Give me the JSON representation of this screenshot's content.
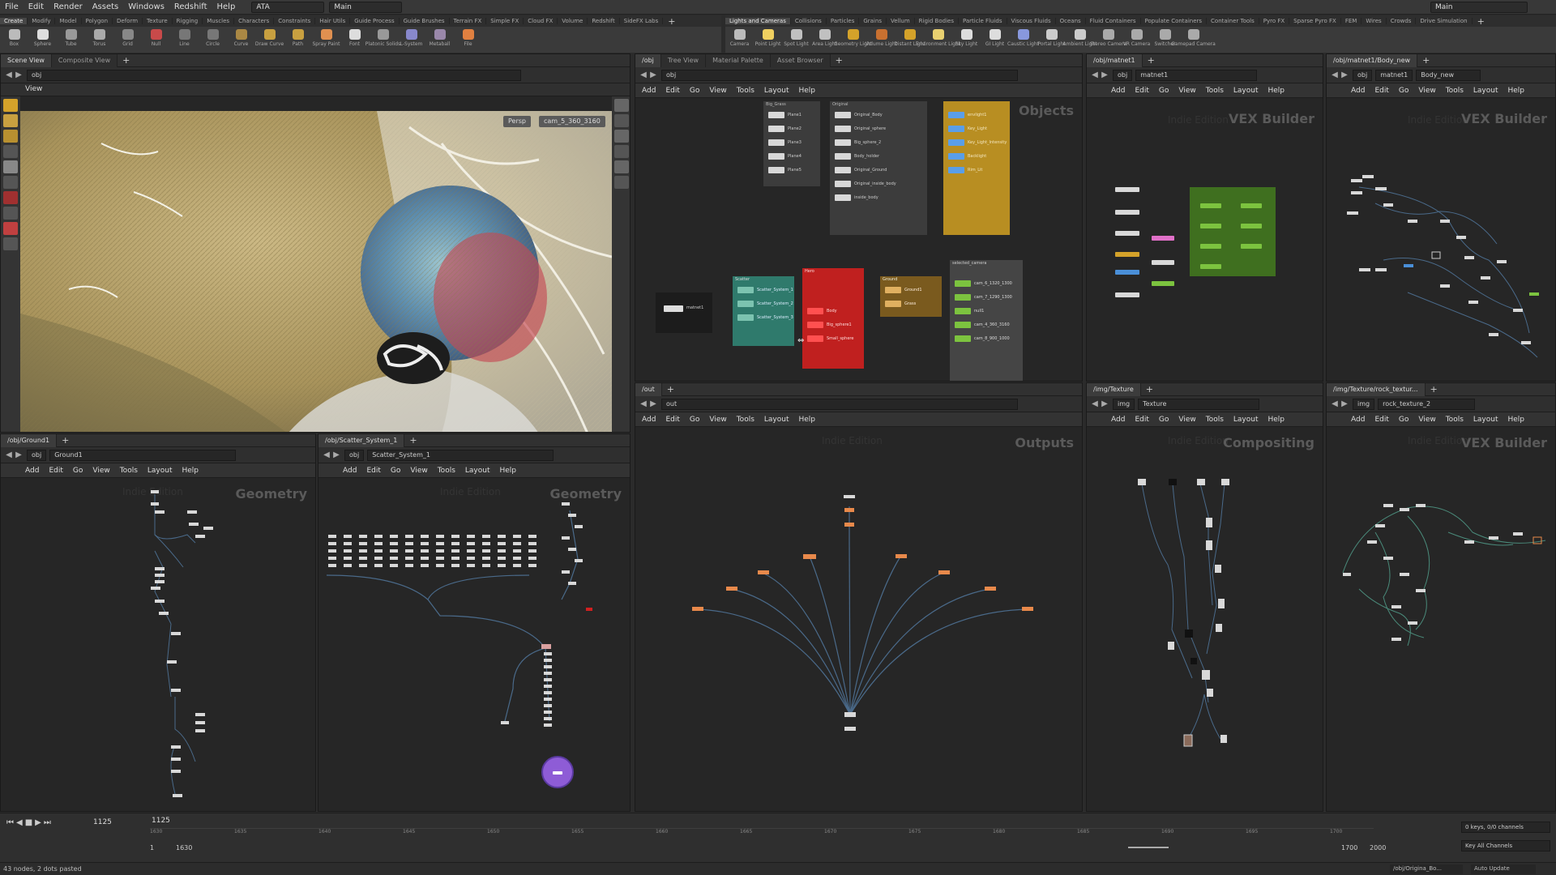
{
  "menu": {
    "items": [
      "File",
      "Edit",
      "Render",
      "Assets",
      "Windows",
      "Redshift",
      "Help"
    ],
    "desktop": "ATA",
    "desktop_right": "Main",
    "main_center": "Main"
  },
  "shelf_left": {
    "tabs": [
      "Create",
      "Modify",
      "Model",
      "Polygon",
      "Deform",
      "Texture",
      "Rigging",
      "Muscles",
      "Characters",
      "Constraints",
      "Hair Utils",
      "Guide Process",
      "Guide Brushes",
      "Terrain FX",
      "Simple FX",
      "Cloud FX",
      "Volume",
      "Redshift",
      "SideFX Labs"
    ],
    "tools": [
      "Box",
      "Sphere",
      "Tube",
      "Torus",
      "Grid",
      "Null",
      "Line",
      "Circle",
      "Curve",
      "Draw Curve",
      "Path",
      "Spray Paint",
      "Font",
      "Platonic Solids",
      "L-System",
      "Metaball",
      "File"
    ]
  },
  "shelf_right": {
    "tabs": [
      "Lights and Cameras",
      "Collisions",
      "Particles",
      "Grains",
      "Vellum",
      "Rigid Bodies",
      "Particle Fluids",
      "Viscous Fluids",
      "Oceans",
      "Fluid Containers",
      "Populate Containers",
      "Container Tools",
      "Pyro FX",
      "Sparse Pyro FX",
      "FEM",
      "Wires",
      "Crowds",
      "Drive Simulation"
    ],
    "tools": [
      "Camera",
      "Point Light",
      "Spot Light",
      "Area Light",
      "Geometry Light",
      "Volume Light",
      "Distant Light",
      "Environment Light",
      "Sky Light",
      "GI Light",
      "Caustic Light",
      "Portal Light",
      "Ambient Light",
      "Stereo Camera",
      "VR Camera",
      "Switcher",
      "Gamepad Camera"
    ]
  },
  "viewport": {
    "tabs": [
      "Scene View",
      "Composite View"
    ],
    "path": "obj",
    "title": "View",
    "persp": "Persp",
    "cam": "cam_5_360_3160"
  },
  "panes": {
    "obj": {
      "tabs": [
        "/obj",
        "Tree View",
        "Material Palette",
        "Asset Browser"
      ],
      "path": "obj",
      "menu": [
        "Add",
        "Edit",
        "Go",
        "View",
        "Tools",
        "Layout",
        "Help"
      ],
      "watermark": "Objects",
      "boxes": {
        "big_grass": "Big_Grass",
        "original": "Original",
        "lights": "",
        "scatter": "Scatter",
        "hero": "Hero",
        "ground": "Ground",
        "cameras": "selected_camera"
      },
      "grass_nodes": [
        "Plane1",
        "Plane2",
        "Plane3",
        "Plane4",
        "Plane5"
      ],
      "orig_nodes": [
        "Original_Body",
        "Original_sphere",
        "Big_sphere_2",
        "Body_holder",
        "Original_Ground",
        "Original_inside_body",
        "inside_body"
      ],
      "light_nodes": [
        "envlight1",
        "Key_Light",
        "Key_Light_Intensity",
        "Backlight",
        "Rim_Lit"
      ],
      "scatter_nodes": [
        "Scatter_System_1",
        "Scatter_System_2",
        "Scatter_System_3"
      ],
      "hero_nodes": [
        "Body",
        "Big_sphere1",
        "Small_sphere"
      ],
      "ground_nodes": [
        "Ground1",
        "Grass"
      ],
      "cam_nodes": [
        "cam_6_1320_1300",
        "cam_7_1290_1300",
        "null1",
        "cam_4_360_3160",
        "cam_8_900_1000"
      ],
      "matnet": "matnet1"
    },
    "vex1": {
      "tab": "/obj/matnet1",
      "path1": "obj",
      "path2": "matnet1",
      "menu": [
        "Add",
        "Edit",
        "Go",
        "View",
        "Tools",
        "Layout",
        "Help"
      ],
      "indie": "Indie Edition",
      "watermark": "VEX Builder"
    },
    "vex2": {
      "tab": "/obj/matnet1/Body_new",
      "path1": "obj",
      "path2": "matnet1",
      "path3": "Body_new",
      "menu": [
        "Add",
        "Edit",
        "Go",
        "View",
        "Tools",
        "Layout",
        "Help"
      ],
      "indie": "Indie Edition",
      "watermark": "VEX Builder"
    },
    "out": {
      "tab": "/out",
      "path": "out",
      "menu": [
        "Add",
        "Edit",
        "Go",
        "View",
        "Tools",
        "Layout",
        "Help"
      ],
      "indie": "Indie Edition",
      "watermark": "Outputs"
    },
    "img": {
      "tab": "/img/Texture",
      "path1": "img",
      "path2": "Texture",
      "menu": [
        "Add",
        "Edit",
        "Go",
        "View",
        "Tools",
        "Layout",
        "Help"
      ],
      "indie": "Indie Edition",
      "watermark": "Compositing"
    },
    "rock": {
      "tab": "/img/Texture/rock_textur...",
      "path1": "img",
      "path2": "rock_texture_2",
      "menu": [
        "Add",
        "Edit",
        "Go",
        "View",
        "Tools",
        "Layout",
        "Help"
      ],
      "indie": "Indie Edition",
      "watermark": "VEX Builder"
    },
    "ground": {
      "tab": "/obj/Ground1",
      "path1": "obj",
      "path2": "Ground1",
      "menu": [
        "Add",
        "Edit",
        "Go",
        "View",
        "Tools",
        "Layout",
        "Help"
      ],
      "indie": "Indie Edition",
      "watermark": "Geometry"
    },
    "scatter": {
      "tab": "/obj/Scatter_System_1",
      "path1": "obj",
      "path2": "Scatter_System_1",
      "menu": [
        "Add",
        "Edit",
        "Go",
        "View",
        "Tools",
        "Layout",
        "Help"
      ],
      "indie": "Indie Edition",
      "watermark": "Geometry"
    }
  },
  "timeline": {
    "frame": "1125",
    "current": "1125",
    "start": "1",
    "start_field": "1630",
    "end1": "1700",
    "end2": "2000",
    "keys": "0 keys, 0/0 channels",
    "key_all": "Key All Channels",
    "ticks": [
      "1630",
      "1635",
      "1640",
      "1645",
      "1650",
      "1655",
      "1660",
      "1665",
      "1670",
      "1675",
      "1680",
      "1685",
      "1690",
      "1695",
      "1700"
    ]
  },
  "status": {
    "left": "43 nodes, 2 dots pasted",
    "path": "/obj/Origina_Bo...",
    "auto": "Auto Update"
  },
  "colors": {
    "accent_orange": "#e8894b",
    "grass_yellow": "#b8a060",
    "node_green": "#7cc33f",
    "node_gold": "#d4a22a",
    "scatter_teal": "#2f7a6c",
    "hero_red": "#c0201f",
    "purple_node": "#8e5cd6"
  }
}
